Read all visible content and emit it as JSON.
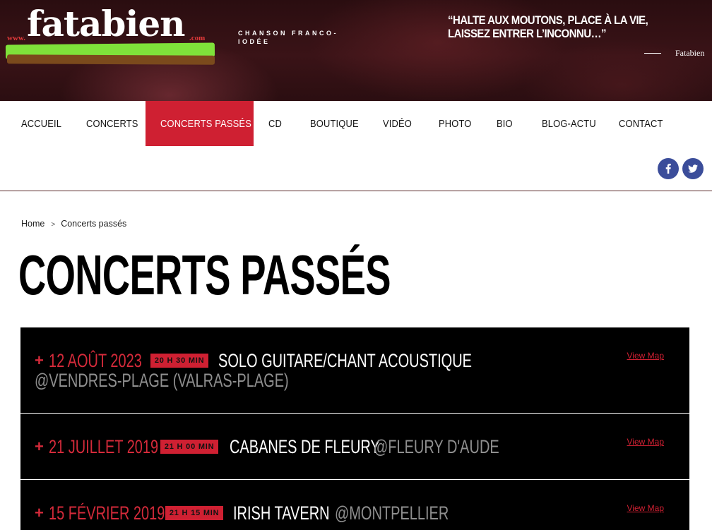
{
  "header": {
    "logo": {
      "prefix": "www.",
      "word": "fatabien",
      "suffix": ".com"
    },
    "tagline": "CHANSON FRANCO-IODÉE",
    "quote": "“HALTE AUX MOUTONS, PLACE À LA VIE, LAISSEZ ENTRER L’INCONNU…”",
    "quote_author": "Fatabien"
  },
  "nav": {
    "items": [
      {
        "label": "ACCUEIL"
      },
      {
        "label": "CONCERTS"
      },
      {
        "label": "CONCERTS PASSÉS",
        "active": true
      },
      {
        "label": "CD"
      },
      {
        "label": "BOUTIQUE"
      },
      {
        "label": "VIDÉO"
      },
      {
        "label": "PHOTO"
      },
      {
        "label": "BIO"
      },
      {
        "label": "BLOG-ACTU"
      },
      {
        "label": "CONTACT"
      }
    ],
    "social": [
      {
        "icon": "facebook-icon",
        "color": "#3b4d9a"
      },
      {
        "icon": "twitter-icon",
        "color": "#3b4d9a"
      }
    ]
  },
  "breadcrumb": {
    "home": "Home",
    "separator": ">",
    "current": "Concerts passés"
  },
  "page_title": "CONCERTS PASSÉS",
  "concerts": [
    {
      "plus": "+",
      "date": "12 AOÛT 2023",
      "time": "20 H 30 MIN",
      "title": "SOLO GUITARE/CHANT ACOUSTIQUE",
      "venue": "@VENDRES-PLAGE (VALRAS-PLAGE)",
      "map_link": "View Map"
    },
    {
      "plus": "+",
      "date": "21 JUILLET 2019",
      "time": "21 H 00 MIN",
      "title": "CABANES DE FLEURY",
      "venue": "@FLEURY D'AUDE",
      "map_link": "View Map"
    },
    {
      "plus": "+",
      "date": "15 FÉVRIER 2019",
      "time": "21 H 15 MIN",
      "title": "IRISH TAVERN",
      "venue": "@MONTPELLIER",
      "map_link": "View Map"
    }
  ],
  "colors": {
    "accent": "#cf2032",
    "header_bg": "#2e0f12",
    "social_bg": "#3b4d9a",
    "concert_bg": "#000000"
  }
}
